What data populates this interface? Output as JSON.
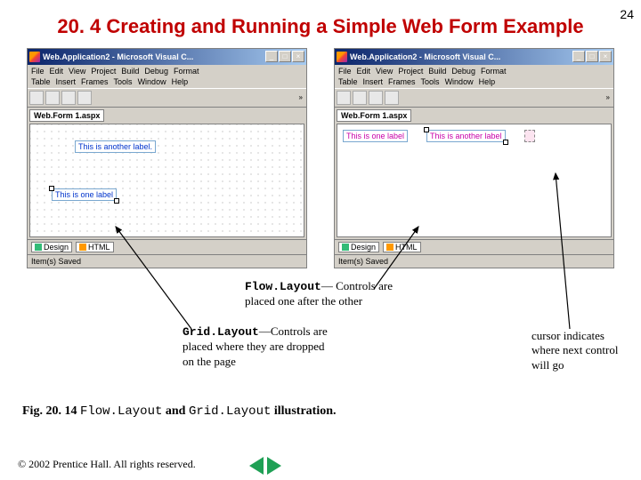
{
  "page_number": "24",
  "title": "20. 4  Creating and Running a Simple Web Form Example",
  "window": {
    "title": "Web.Application2 - Microsoft Visual C...",
    "menus_row1": [
      "File",
      "Edit",
      "View",
      "Project",
      "Build",
      "Debug",
      "Format"
    ],
    "menus_row2": [
      "Table",
      "Insert",
      "Frames",
      "Tools",
      "Window",
      "Help"
    ],
    "doc_tab": "Web.Form 1.aspx",
    "design_tab": "Design",
    "html_tab": "HTML",
    "status": "Item(s) Saved",
    "win_btn_min": "_",
    "win_btn_max": "□",
    "win_btn_close": "×"
  },
  "left_design": {
    "label1": "This is another label.",
    "label2": "This is one label"
  },
  "right_design": {
    "label1": "This is one label",
    "label2": "This is another label"
  },
  "annotations": {
    "flow": {
      "bold": "Flow.Layout",
      "rest": "— Controls are placed one after the other"
    },
    "grid": {
      "bold": "Grid.Layout",
      "rest": "—Controls are placed where they are dropped on the page"
    },
    "cursor": "cursor indicates where next control will go"
  },
  "fig_caption": {
    "prefix": "Fig. 20. 14 ",
    "term1": "Flow.Layout",
    "mid": " and ",
    "term2": "Grid.Layout",
    "suffix": " illustration."
  },
  "copyright": "© 2002 Prentice Hall.  All rights reserved."
}
